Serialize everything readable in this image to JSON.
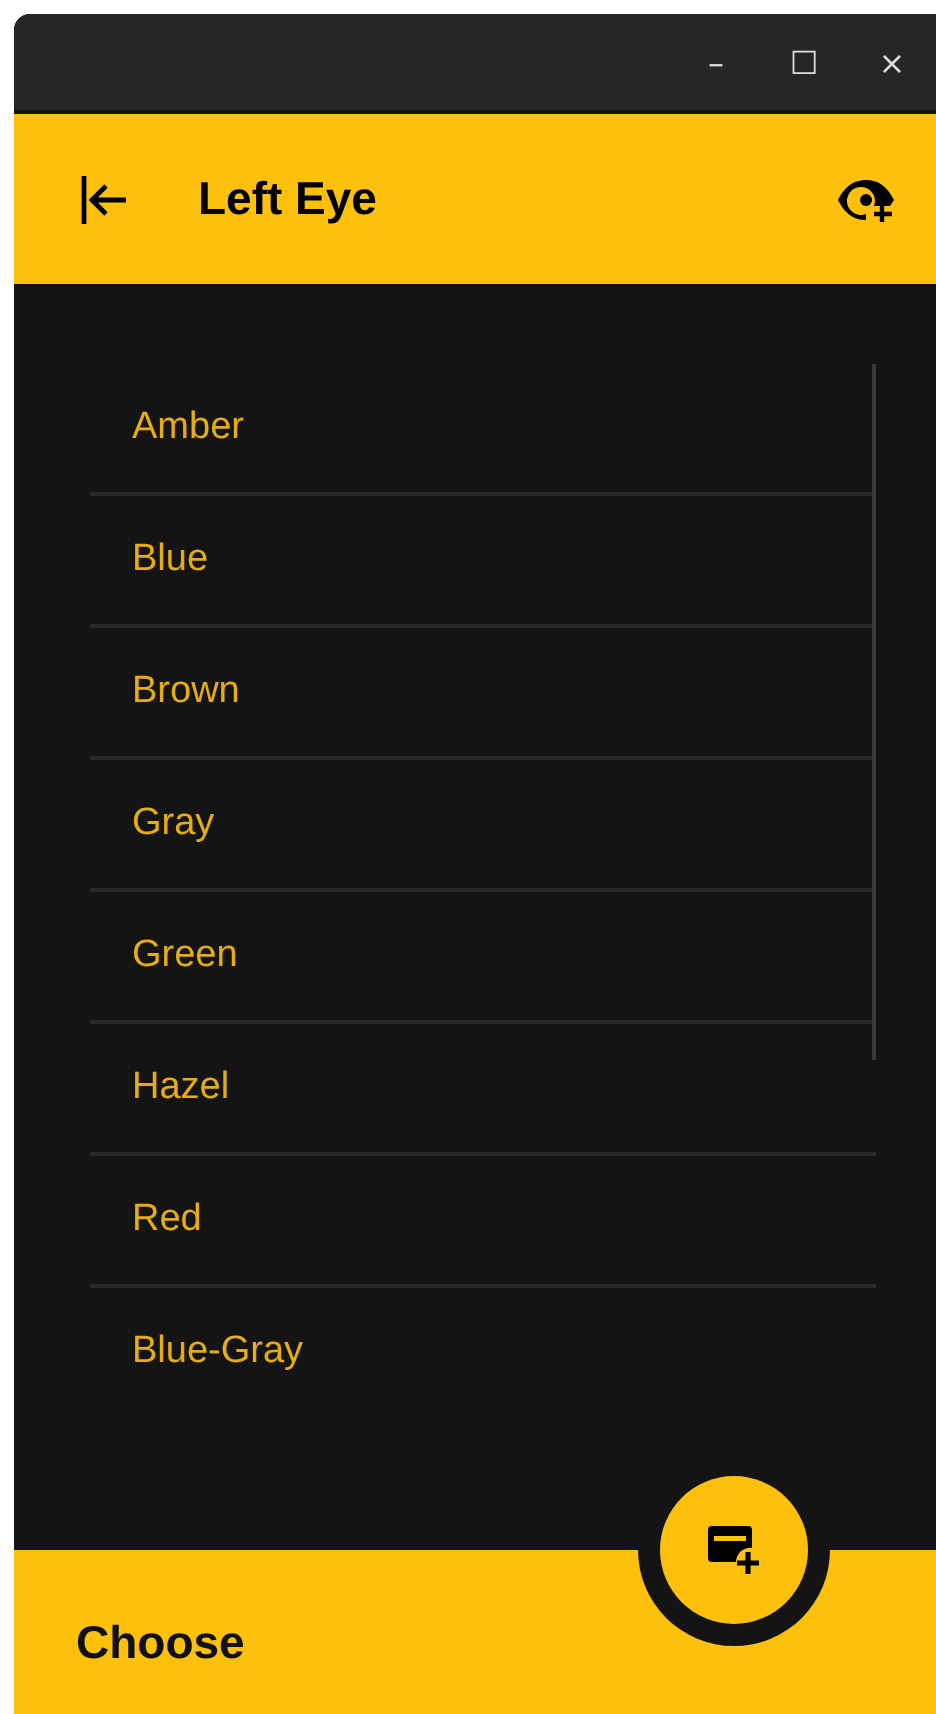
{
  "window": {
    "controls": [
      "–",
      "☐",
      "×"
    ]
  },
  "header": {
    "title": "Left Eye"
  },
  "list": {
    "items": [
      {
        "label": "Amber"
      },
      {
        "label": "Blue"
      },
      {
        "label": "Brown"
      },
      {
        "label": "Gray"
      },
      {
        "label": "Green"
      },
      {
        "label": "Hazel"
      },
      {
        "label": "Red"
      },
      {
        "label": "Blue-Gray"
      }
    ]
  },
  "footer": {
    "label": "Choose"
  }
}
